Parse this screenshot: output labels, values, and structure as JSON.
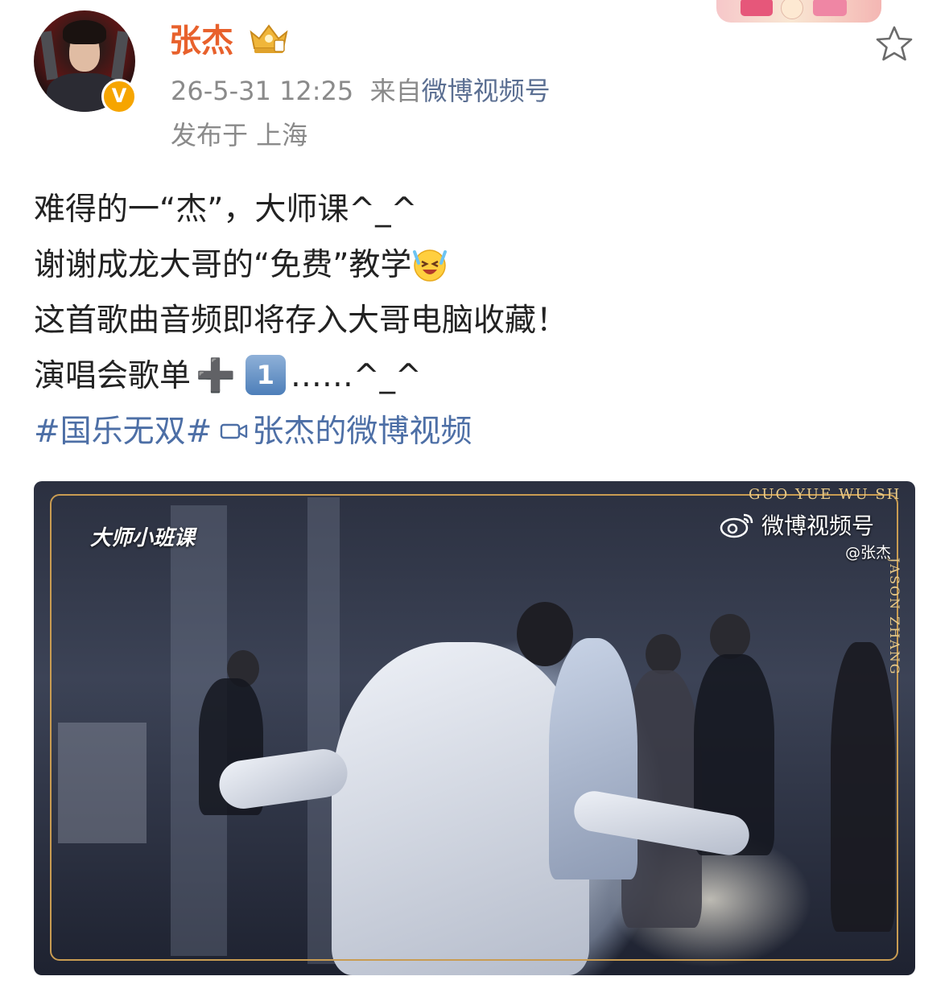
{
  "header": {
    "username": "张杰",
    "timestamp": "26-5-31 12:25",
    "source_prefix": "来自",
    "source": "微博视频号",
    "location": "发布于 上海",
    "verified_mark": "V"
  },
  "post": {
    "line1": "难得的一“杰”，大师课^_^",
    "line2_text": "谢谢成龙大哥的“免费”教学",
    "line2_emoji": "laughing-crying-emoji",
    "line3": "这首歌曲音频即将存入大哥电脑收藏！",
    "line4_text": "演唱会歌单",
    "line4_plus": "➕",
    "line4_keycap": "1",
    "line4_tail": "……^_^",
    "hashtag": "#国乐无双#",
    "video_link": "张杰的微博视频"
  },
  "video": {
    "label": "大师小班课",
    "watermark_brand": "微博视频号",
    "watermark_user": "@张杰",
    "deco_top": "GUO YUE WU SH",
    "deco_side": "JASON ZHANG"
  },
  "colors": {
    "username": "#e8612c",
    "meta": "#8a8a8a",
    "link": "#4d6fa6",
    "frame_gold": "#c99c52"
  },
  "icons": {
    "favorite": "star-outline-icon",
    "member_badge": "crown-icon",
    "verified": "verified-v-icon",
    "video_link": "video-camera-icon",
    "watermark": "weibo-logo-icon"
  }
}
